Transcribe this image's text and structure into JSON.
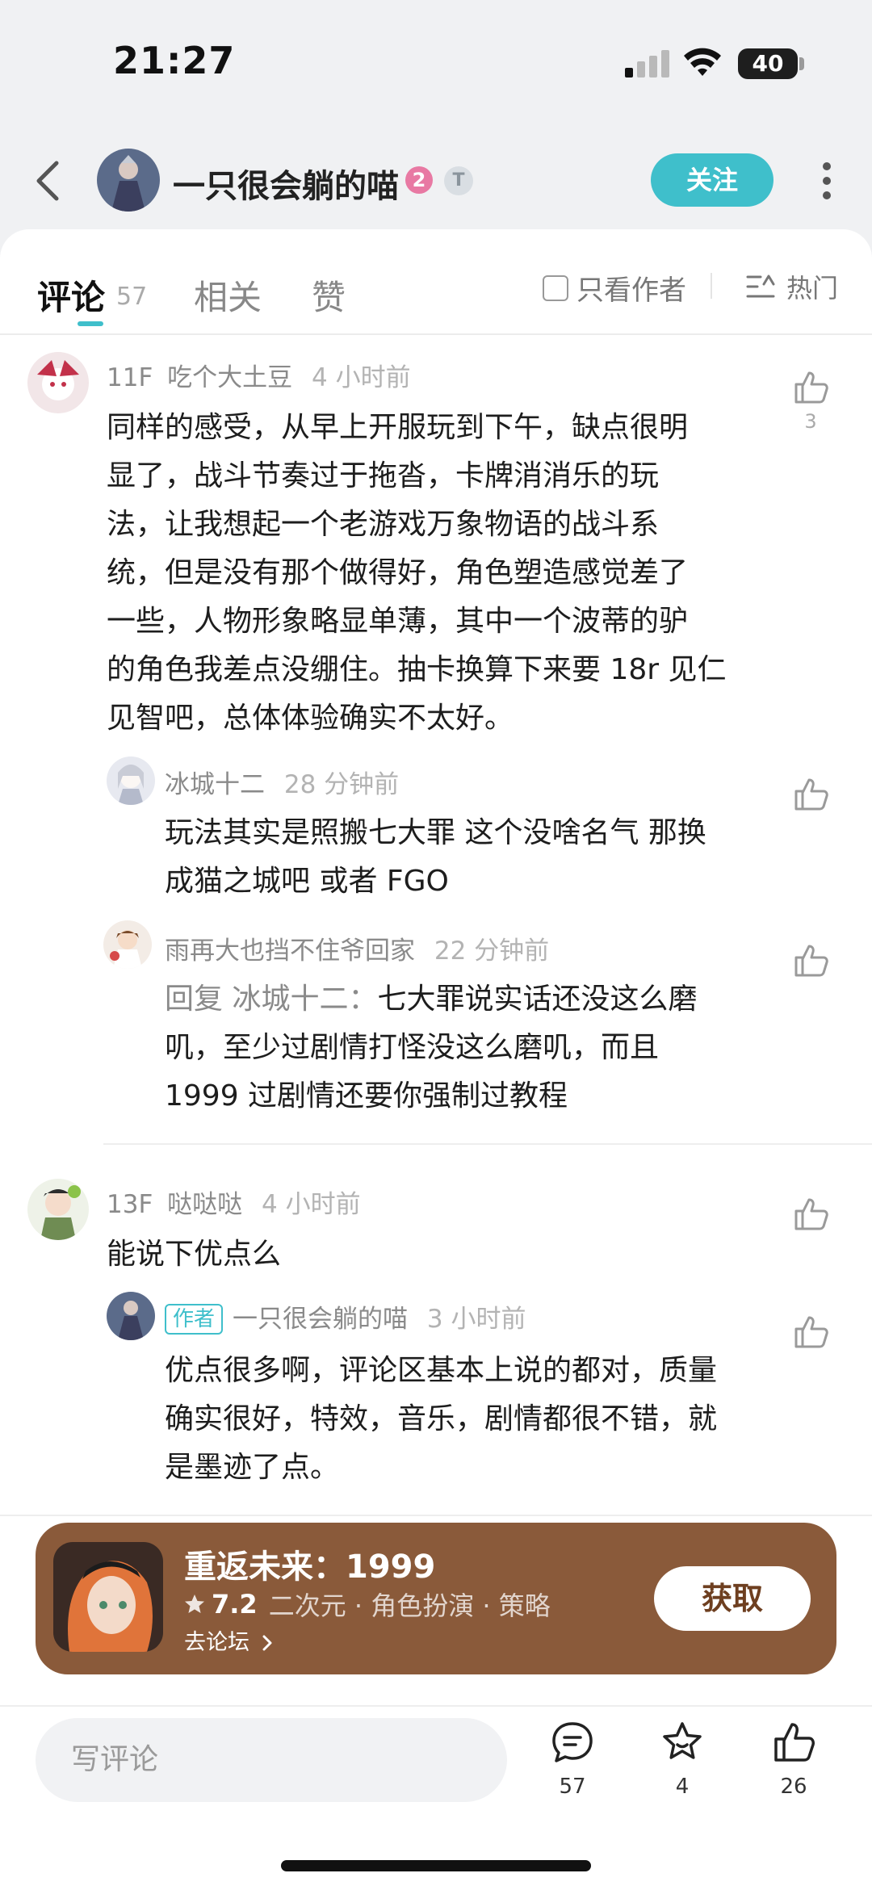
{
  "status_bar": {
    "time": "21:27",
    "battery": "40"
  },
  "header": {
    "username": "一只很会躺的喵",
    "level": "2",
    "title_badge": "T",
    "follow_label": "关注"
  },
  "tabs": {
    "comments_label": "评论",
    "comments_count": "57",
    "related_label": "相关",
    "likes_label": "赞",
    "only_author_label": "只看作者",
    "sort_label": "热门"
  },
  "comments": [
    {
      "floor": "11F",
      "user": "吃个大土豆",
      "time": "4 小时前",
      "likes": "3",
      "lines": [
        "同样的感受，从早上开服玩到下午，缺点很明",
        "显了，战斗节奏过于拖沓，卡牌消消乐的玩",
        "法，让我想起一个老游戏万象物语的战斗系",
        "统，但是没有那个做得好，角色塑造感觉差了",
        "一些，人物形象略显单薄，其中一个波蒂的驴",
        "的角色我差点没绷住。抽卡换算下来要 18r 见仁",
        "见智吧，总体体验确实不太好。"
      ],
      "replies": [
        {
          "user": "冰城十二",
          "time": "28 分钟前",
          "lines": [
            "玩法其实是照搬七大罪 这个没啥名气 那换",
            "成猫之城吧 或者 FGO"
          ]
        },
        {
          "user": "雨再大也挡不住爷回家",
          "time": "22 分钟前",
          "reply_prefix": "回复 冰城十二：",
          "lines": [
            "七大罪说实话还没这么磨",
            "叽，至少过剧情打怪没这么磨叽，而且",
            "1999 过剧情还要你强制过教程"
          ]
        }
      ]
    },
    {
      "floor": "13F",
      "user": "哒哒哒",
      "time": "4 小时前",
      "lines": [
        "能说下优点么"
      ],
      "replies": [
        {
          "author_tag": "作者",
          "user": "一只很会躺的喵",
          "time": "3 小时前",
          "lines": [
            "优点很多啊，评论区基本上说的都对，质量",
            "确实很好，特效，音乐，剧情都很不错，就",
            "是墨迹了点。"
          ]
        }
      ]
    }
  ],
  "game_card": {
    "name": "重返未来：1999",
    "score": "7.2",
    "tags": "二次元 · 角色扮演 · 策略",
    "forum_link": "去论坛",
    "get_label": "获取",
    "color": "#8a5a3a"
  },
  "bottom_bar": {
    "input_placeholder": "写评论",
    "comment_count": "57",
    "favorite_count": "4",
    "like_count": "26"
  },
  "colors": {
    "accent": "#3fbfcb",
    "level_badge": "#e879a3"
  }
}
